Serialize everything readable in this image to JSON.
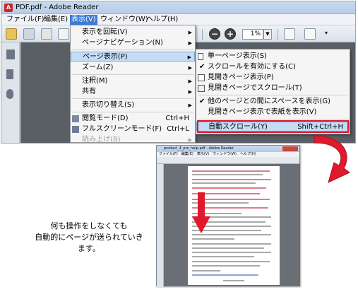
{
  "window": {
    "title": "PDF.pdf - Adobe Reader",
    "app_icon": "adobe-reader-icon"
  },
  "menubar": {
    "items": [
      {
        "label": "ファイル(F)"
      },
      {
        "label": "編集(E)"
      },
      {
        "label": "表示(V)",
        "active": true
      },
      {
        "label": "ウィンドウ(W)"
      },
      {
        "label": "ヘルプ(H)"
      }
    ]
  },
  "toolbar": {
    "zoom_value": "1%",
    "zoom_out_symbol": "−",
    "zoom_in_symbol": "+",
    "more_symbol": "▾"
  },
  "view_menu": {
    "items": [
      {
        "label": "表示を回転(V)",
        "submenu": true
      },
      {
        "label": "ページナビゲーション(N)",
        "submenu": true
      },
      {
        "label": "ページ表示(P)",
        "submenu": true,
        "highlighted": true
      },
      {
        "label": "ズーム(Z)",
        "submenu": true
      },
      {
        "label": "注釈(M)",
        "submenu": true
      },
      {
        "label": "共有",
        "submenu": true
      },
      {
        "label": "表示切り替え(S)",
        "submenu": true
      },
      {
        "label": "閲覧モード(D)",
        "shortcut": "Ctrl+H"
      },
      {
        "label": "フルスクリーンモード(F)",
        "shortcut": "Ctrl+L"
      },
      {
        "label": "読み上げ(B)",
        "submenu": true,
        "disabled": true
      }
    ]
  },
  "page_display_submenu": {
    "items": [
      {
        "label": "単一ページ表示(S)"
      },
      {
        "label": "スクロールを有効にする(C)",
        "checked": true
      },
      {
        "label": "見開きページ表示(P)"
      },
      {
        "label": "見開きページでスクロール(T)"
      },
      {
        "label": "他のページとの間にスペースを表示(G)",
        "checked": true
      },
      {
        "label": "見開きページ表示で表紙を表示(V)"
      },
      {
        "label": "自動スクロール(Y)",
        "shortcut": "Shift+Ctrl+H",
        "highlighted": true
      }
    ]
  },
  "preview": {
    "title": "product_4_pro_help.pdf - Adobe Reader",
    "menu": "ファイル(F)　編集(E)　表示(V)　ウィンドウ(W)　ヘルプ(H)"
  },
  "callout": {
    "line1": "何も操作をしなくても",
    "line2": "自動的にページが送られていきます。"
  },
  "colors": {
    "accent": "#3d7bd7",
    "highlight": "#c5dcf5",
    "callout_red": "#e0192d"
  }
}
